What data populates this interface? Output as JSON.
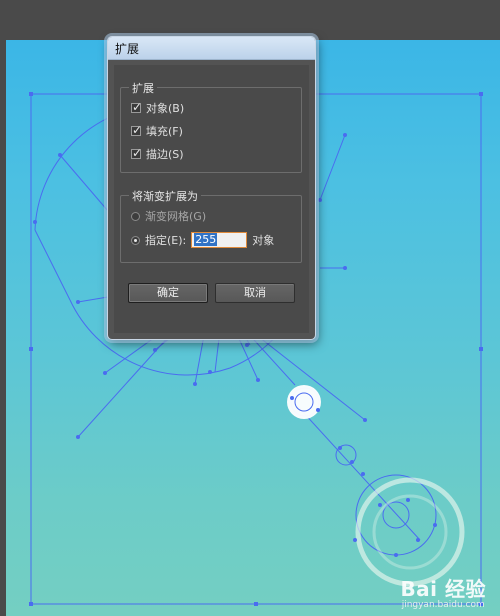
{
  "colors": {
    "canvas_top": "#3bb6e6",
    "canvas_bottom": "#74cfc2",
    "path_blue": "#4a6cf0",
    "dialog_bg": "#535353",
    "input_focus": "#e08a3a",
    "selection": "#3173c6"
  },
  "dialog": {
    "title": "扩展",
    "expand_group": {
      "legend": "扩展",
      "options": [
        {
          "label": "对象(B)",
          "checked": true
        },
        {
          "label": "填充(F)",
          "checked": true
        },
        {
          "label": "描边(S)",
          "checked": true
        }
      ]
    },
    "gradient_group": {
      "legend": "将渐变扩展为",
      "gradient_mesh_label": "渐变网格(G)",
      "specify_label": "指定(E):",
      "specify_value": "255",
      "objects_suffix": "对象"
    },
    "ok_label": "确定",
    "cancel_label": "取消"
  },
  "watermark": {
    "main": "Bai 经验",
    "sub": "jingyan.baidu.com"
  }
}
